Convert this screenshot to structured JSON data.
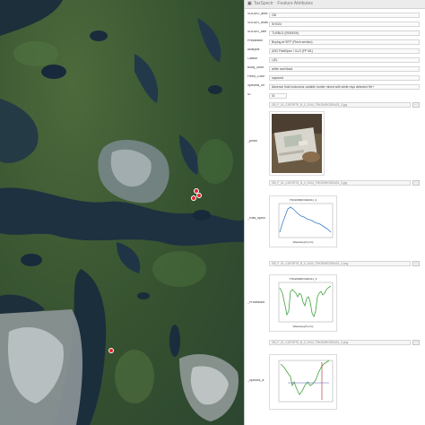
{
  "window": {
    "title": "TaxSpectr · Feature Attributes"
  },
  "map": {
    "markers": [
      {
        "name": "sample-marker-1"
      },
      {
        "name": "sample-marker-2"
      },
      {
        "name": "sample-marker-3"
      },
      {
        "name": "sample-marker-4"
      }
    ]
  },
  "attributes": [
    {
      "label": "SODDO_area",
      "value": "OB"
    },
    {
      "label": "SODDO_dnas",
      "value": "SHO24"
    },
    {
      "label": "SODDO_fam",
      "value": "TUSBLD (R000000)"
    },
    {
      "label": "Preparator",
      "value": "Buying at 90°F (Flesh section)"
    },
    {
      "label": "Analysis",
      "value": "ASD FieldSpec / ILLS (FP M1)"
    },
    {
      "label": "Classif",
      "value": "L(E)"
    },
    {
      "label": "Body_color",
      "value": "white and black"
    },
    {
      "label": "Flesh_Color",
      "value": "saponed"
    },
    {
      "label": "Spectral_ch",
      "value": "Absence fluid inclusions variable border mixed with white rays detected Hb+"
    },
    {
      "label": "ID",
      "value": "01"
    }
  ],
  "photo_section": {
    "label": "_photo",
    "path_top": "GB_F_01_CATORTS_B_0_2044_TSK294ROGRAS1_3.jpg",
    "path_bottom": "GB_F_01_CATORTS_B_0_2044_TSK294ROGRAS1_3.jpg"
  },
  "spec1_section": {
    "label": "_Raw_spect",
    "chart_title": "TSK2006ROGRAS1_2",
    "xlabel": "Wavelength (nm)",
    "path": "GB_F_01_CATORTS_B_0_2044_TSK294ROGRAS1_2.png"
  },
  "spec2_section": {
    "label": "_Processed",
    "chart_title": "TSK2006ROGRAS1_3",
    "xlabel": "Wavelength (nm)",
    "path": "GB_F_01_CATORTS_B_0_2044_TSK294ROGRAS1_3.png"
  },
  "spec3_section": {
    "label": "_Spectra_a"
  },
  "browse_label": "…",
  "colors": {
    "marker": "#e4262a",
    "spectrum_line": "#3b7fc4",
    "processed_line": "#3da33a",
    "segment_line": "#b64141"
  }
}
